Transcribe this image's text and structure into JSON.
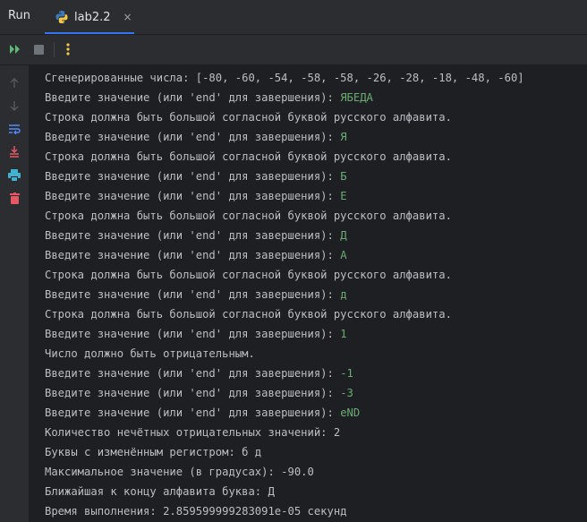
{
  "header": {
    "run_title": "Run",
    "tab_label": "lab2.2",
    "close_glyph": "×"
  },
  "toolbar": {
    "rerun_icon": "rerun-icon",
    "stop_icon": "stop-icon",
    "more_icon": "more-options-icon"
  },
  "sidebar": {
    "icons": [
      "arrow-up-icon",
      "arrow-down-icon",
      "soft-wrap-icon",
      "scroll-to-end-icon",
      "print-icon",
      "trash-icon"
    ]
  },
  "colors": {
    "background": "#2b2d30",
    "console_background": "#1e1f22",
    "output_text": "#bcbec4",
    "user_input": "#6aab73",
    "accent": "#3574f0"
  },
  "console": {
    "lines": [
      {
        "text": "Сгенерированные числа: [-80, -60, -54, -58, -58, -26, -28, -18, -48, -60]",
        "input": ""
      },
      {
        "text": "Введите значение (или 'end' для завершения): ",
        "input": "ЯБЕДА"
      },
      {
        "text": "Строка должна быть большой согласной буквой русского алфавита.",
        "input": ""
      },
      {
        "text": "Введите значение (или 'end' для завершения): ",
        "input": "Я"
      },
      {
        "text": "Строка должна быть большой согласной буквой русского алфавита.",
        "input": ""
      },
      {
        "text": "Введите значение (или 'end' для завершения): ",
        "input": "Б"
      },
      {
        "text": "Введите значение (или 'end' для завершения): ",
        "input": "Е"
      },
      {
        "text": "Строка должна быть большой согласной буквой русского алфавита.",
        "input": ""
      },
      {
        "text": "Введите значение (или 'end' для завершения): ",
        "input": "Д"
      },
      {
        "text": "Введите значение (или 'end' для завершения): ",
        "input": "А"
      },
      {
        "text": "Строка должна быть большой согласной буквой русского алфавита.",
        "input": ""
      },
      {
        "text": "Введите значение (или 'end' для завершения): ",
        "input": "д"
      },
      {
        "text": "Строка должна быть большой согласной буквой русского алфавита.",
        "input": ""
      },
      {
        "text": "Введите значение (или 'end' для завершения): ",
        "input": "1"
      },
      {
        "text": "Число должно быть отрицательным.",
        "input": ""
      },
      {
        "text": "Введите значение (или 'end' для завершения): ",
        "input": "-1"
      },
      {
        "text": "Введите значение (или 'end' для завершения): ",
        "input": "-3"
      },
      {
        "text": "Введите значение (или 'end' для завершения): ",
        "input": "eND"
      },
      {
        "text": "Количество нечётных отрицательных значений: 2",
        "input": ""
      },
      {
        "text": "Буквы с изменённым регистром: б д",
        "input": ""
      },
      {
        "text": "Максимальное значение (в градусах): -90.0",
        "input": ""
      },
      {
        "text": "Ближайшая к концу алфавита буква: Д",
        "input": ""
      },
      {
        "text": "Время выполнения: 2.859599999283091e-05 секунд",
        "input": ""
      }
    ]
  }
}
